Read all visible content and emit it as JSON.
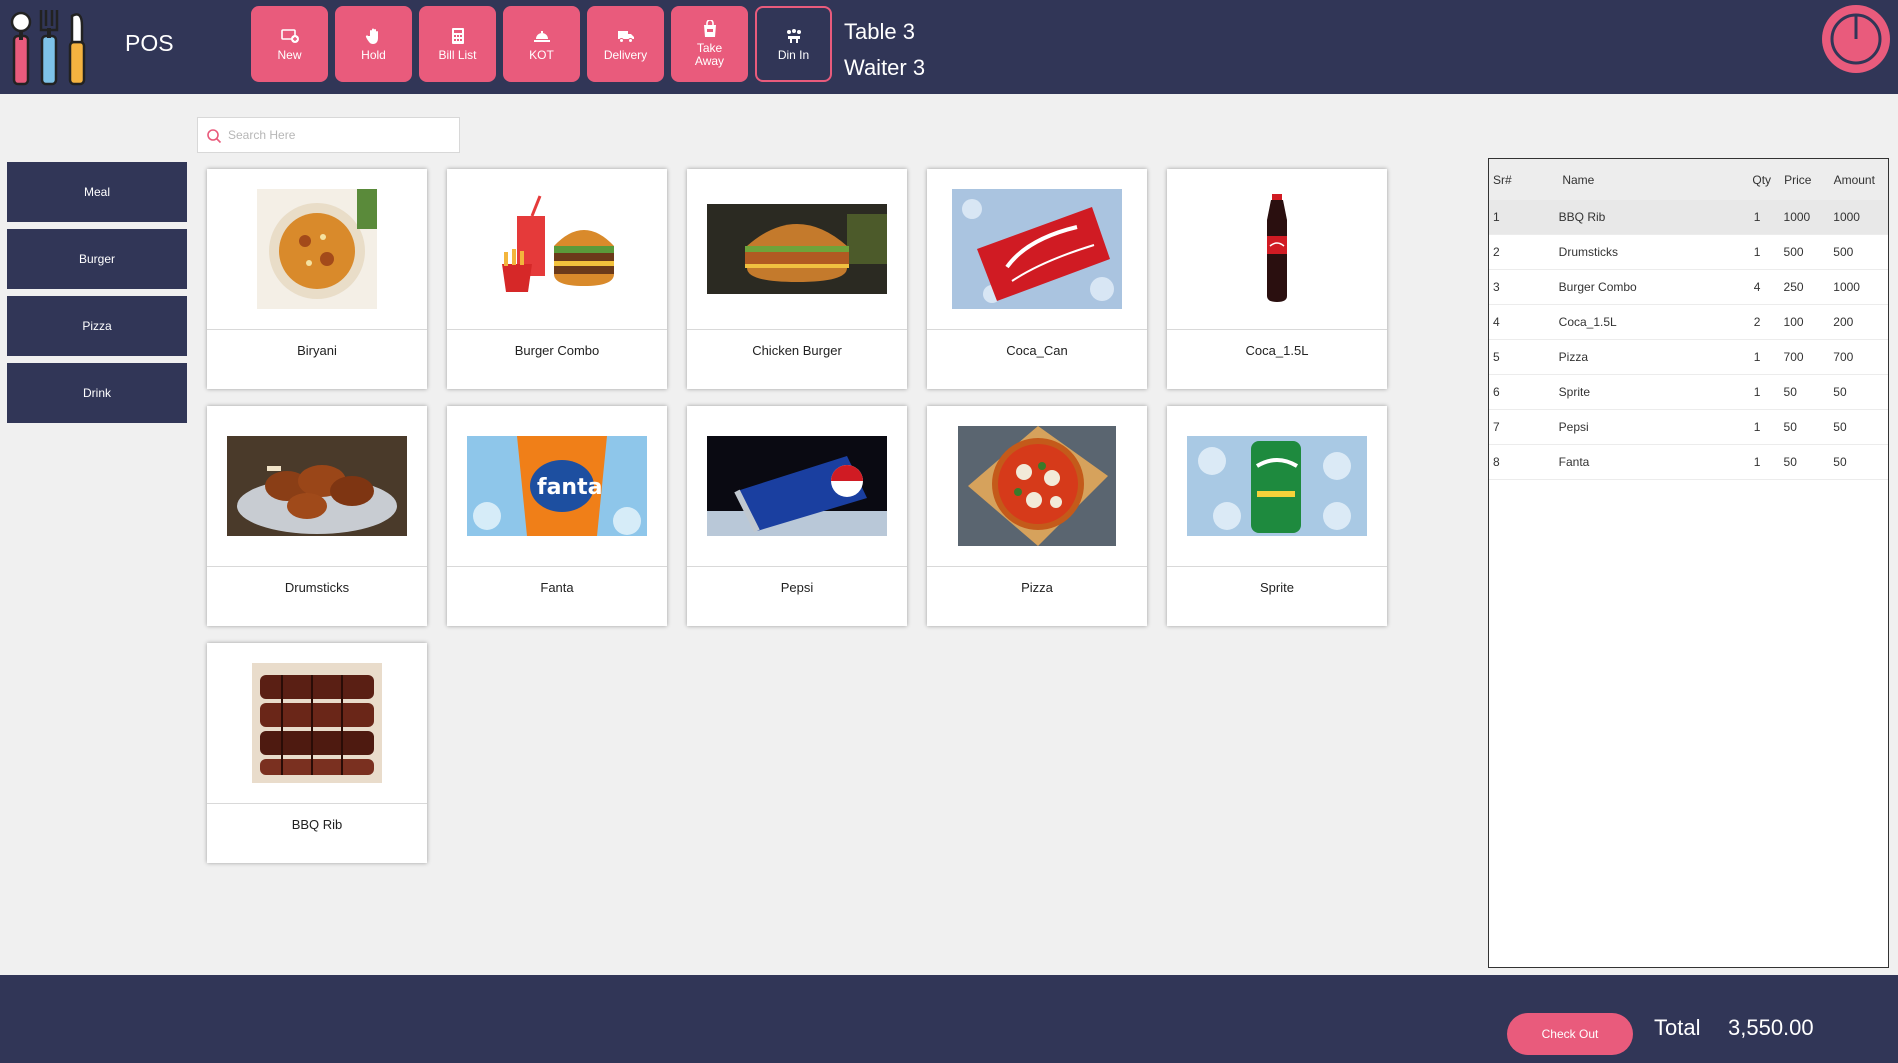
{
  "app": {
    "title": "POS"
  },
  "toolbar": [
    {
      "label": "New",
      "icon": "new-icon",
      "active": false
    },
    {
      "label": "Hold",
      "icon": "hand-icon",
      "active": false
    },
    {
      "label": "Bill List",
      "icon": "calculator-icon",
      "active": false
    },
    {
      "label": "KOT",
      "icon": "kot-icon",
      "active": false
    },
    {
      "label": "Delivery",
      "icon": "truck-icon",
      "active": false
    },
    {
      "label": "Take\nAway",
      "icon": "takeaway-bag-icon",
      "active": false
    },
    {
      "label": "Din In",
      "icon": "dine-in-icon",
      "active": true
    }
  ],
  "order_info": {
    "table": "Table 3",
    "waiter": "Waiter 3"
  },
  "search": {
    "placeholder": "Search Here",
    "value": ""
  },
  "categories": [
    "Meal",
    "Burger",
    "Pizza",
    "Drink"
  ],
  "products": [
    {
      "name": "Biryani",
      "image": "biryani-image"
    },
    {
      "name": "Burger Combo",
      "image": "burger-combo-image"
    },
    {
      "name": "Chicken Burger",
      "image": "chicken-burger-image"
    },
    {
      "name": "Coca_Can",
      "image": "coca-can-image"
    },
    {
      "name": "Coca_1.5L",
      "image": "coca-bottle-image"
    },
    {
      "name": "Drumsticks",
      "image": "drumsticks-image"
    },
    {
      "name": "Fanta",
      "image": "fanta-image"
    },
    {
      "name": "Pepsi",
      "image": "pepsi-image"
    },
    {
      "name": "Pizza",
      "image": "pizza-image"
    },
    {
      "name": "Sprite",
      "image": "sprite-image"
    },
    {
      "name": "BBQ Rib",
      "image": "bbq-rib-image"
    }
  ],
  "order_table": {
    "columns": [
      "Sr#",
      "Name",
      "Qty",
      "Price",
      "Amount"
    ],
    "rows": [
      {
        "sr": "1",
        "name": "BBQ Rib",
        "qty": "1",
        "price": "1000",
        "amount": "1000"
      },
      {
        "sr": "2",
        "name": "Drumsticks",
        "qty": "1",
        "price": "500",
        "amount": "500"
      },
      {
        "sr": "3",
        "name": "Burger Combo",
        "qty": "4",
        "price": "250",
        "amount": "1000"
      },
      {
        "sr": "4",
        "name": "Coca_1.5L",
        "qty": "2",
        "price": "100",
        "amount": "200"
      },
      {
        "sr": "5",
        "name": "Pizza",
        "qty": "1",
        "price": "700",
        "amount": "700"
      },
      {
        "sr": "6",
        "name": "Sprite",
        "qty": "1",
        "price": "50",
        "amount": "50"
      },
      {
        "sr": "7",
        "name": "Pepsi",
        "qty": "1",
        "price": "50",
        "amount": "50"
      },
      {
        "sr": "8",
        "name": "Fanta",
        "qty": "1",
        "price": "50",
        "amount": "50"
      }
    ]
  },
  "footer": {
    "checkout_label": "Check Out",
    "total_label": "Total",
    "total_value": "3,550.00"
  },
  "colors": {
    "navy": "#313657",
    "pink": "#e95b7c",
    "background": "#f0f0f0"
  }
}
